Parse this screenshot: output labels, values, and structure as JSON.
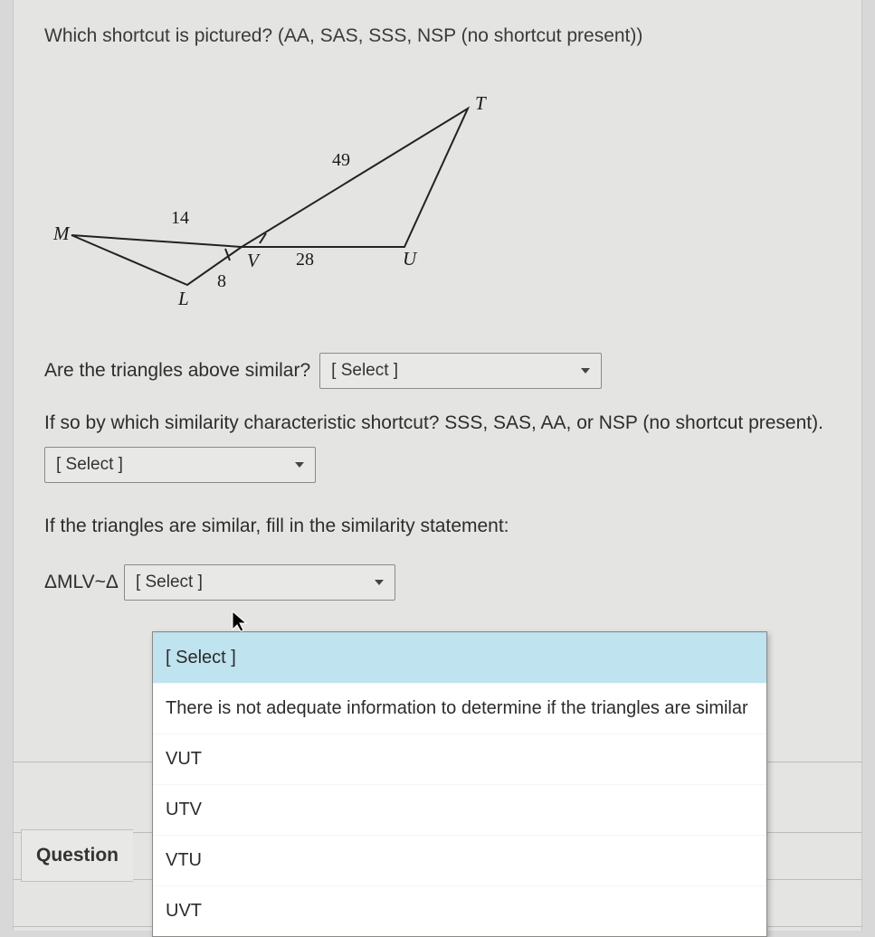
{
  "prompt": "Which shortcut is pictured? (AA, SAS, SSS, NSP (no shortcut present))",
  "figure": {
    "points": {
      "M": "M",
      "L": "L",
      "V": "V",
      "U": "U",
      "T": "T"
    },
    "lengths": {
      "ML": "14",
      "LV": "8",
      "VU": "28",
      "VT": "49"
    }
  },
  "q1": {
    "text": "Are the triangles above similar?",
    "select": "[ Select ]"
  },
  "q2": {
    "text": "If so by which similarity characteristic shortcut? SSS, SAS, AA, or NSP (no shortcut present).",
    "select": "[ Select ]"
  },
  "q3": {
    "text": "If the triangles are similar, fill in the similarity statement:",
    "prefix": "ΔMLV~Δ",
    "select": "[ Select ]"
  },
  "dropdown": {
    "options": [
      "[ Select ]",
      "There is not adequate information to determine if the triangles are similar",
      "VUT",
      "UTV",
      "VTU",
      "UVT"
    ]
  },
  "question_tab": "Question"
}
